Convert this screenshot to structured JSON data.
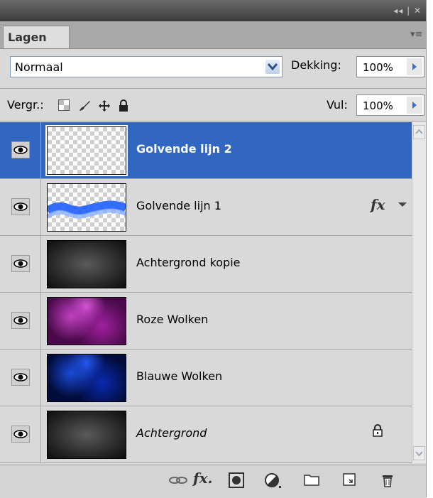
{
  "panel": {
    "tab_label": "Lagen",
    "blend_mode": "Normaal",
    "opacity_label": "Dekking:",
    "opacity_value": "100%",
    "lock_label": "Vergr.:",
    "fill_label": "Vul:",
    "fill_value": "100%"
  },
  "titlebar": {
    "controls": "◂◂ | ✕"
  },
  "layers": [
    {
      "name": "Golvende lijn 2",
      "selected": true,
      "thumb": "transparent"
    },
    {
      "name": "Golvende lijn 1",
      "fx": "fx",
      "thumb": "wave"
    },
    {
      "name": "Achtergrond kopie",
      "thumb": "dark"
    },
    {
      "name": "Roze Wolken",
      "thumb": "pink"
    },
    {
      "name": "Blauwe Wolken",
      "thumb": "blue"
    },
    {
      "name": "Achtergrond",
      "locked": true,
      "thumb": "dark"
    }
  ],
  "colors": {
    "selected": "#3167c0",
    "panel_bg": "#d9d9d9",
    "wave": "#1f5fff"
  },
  "bottom_icons": [
    "link-icon",
    "fx-icon",
    "mask-icon",
    "adjustment-icon",
    "folder-icon",
    "new-layer-icon",
    "trash-icon"
  ]
}
